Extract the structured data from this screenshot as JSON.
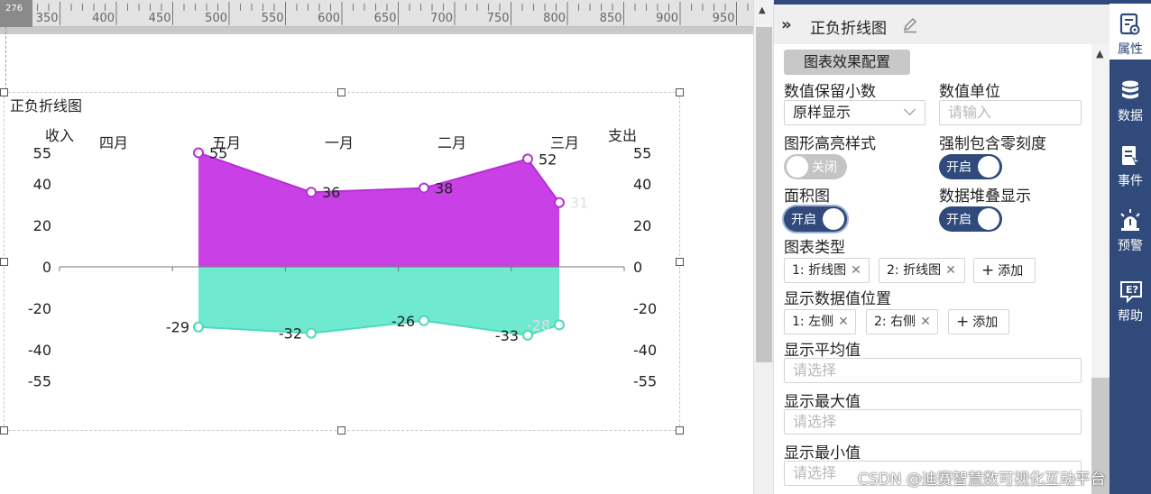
{
  "ruler": {
    "corner_value": "276",
    "ticks": [
      "300",
      "350",
      "400",
      "450",
      "500",
      "550",
      "600",
      "650",
      "700",
      "750",
      "800",
      "850",
      "900",
      "950"
    ]
  },
  "panel": {
    "title": "正负折线图",
    "section_tag": "图表效果配置",
    "decimal_label": "数值保留小数",
    "decimal_value": "原样显示",
    "unit_label": "数值单位",
    "unit_placeholder": "请输入",
    "highlight_label": "图形高亮样式",
    "highlight_toggle": "关闭",
    "zero_label": "强制包含零刻度",
    "zero_toggle": "开启",
    "area_label": "面积图",
    "area_toggle": "开启",
    "stack_label": "数据堆叠显示",
    "stack_toggle": "开启",
    "chart_type_label": "图表类型",
    "chart_types": [
      "1: 折线图",
      "2: 折线图"
    ],
    "add_label": "添加",
    "position_label": "显示数据值位置",
    "positions": [
      "1: 左侧",
      "2: 右侧"
    ],
    "avg_label": "显示平均值",
    "max_label": "显示最大值",
    "min_label": "显示最小值",
    "select_placeholder": "请选择"
  },
  "nav": [
    {
      "icon": "properties-icon",
      "label": "属性"
    },
    {
      "icon": "data-icon",
      "label": "数据"
    },
    {
      "icon": "event-icon",
      "label": "事件"
    },
    {
      "icon": "alarm-icon",
      "label": "预警"
    },
    {
      "icon": "help-icon",
      "label": "帮助"
    }
  ],
  "watermark": "CSDN @迪赛智慧数可视化互动平台",
  "colors": {
    "positive": "#c840e6",
    "negative": "#6fe9d0",
    "nav": "#2f4a7b"
  },
  "chart_data": {
    "type": "area",
    "title": "正负折线图",
    "left_axis_label": "收入",
    "right_axis_label": "支出",
    "categories": [
      "四月",
      "五月",
      "一月",
      "二月",
      "三月"
    ],
    "tick_labels": [
      "55",
      "40",
      "20",
      "0",
      "-20",
      "-40",
      "-55"
    ],
    "ylim": [
      -55,
      55
    ],
    "positive_points": [
      [
        1,
        55
      ],
      [
        2,
        36
      ],
      [
        3,
        38
      ],
      [
        3.92,
        52
      ],
      [
        4.2,
        31
      ]
    ],
    "negative_points": [
      [
        1,
        -29
      ],
      [
        2,
        -32
      ],
      [
        3,
        -26
      ],
      [
        3.92,
        -33
      ],
      [
        4.2,
        -28
      ]
    ],
    "positive_labels": [
      "55",
      "36",
      "38",
      "52",
      "31"
    ],
    "negative_labels": [
      "-29",
      "-32",
      "-26",
      "-33",
      "-28"
    ]
  }
}
